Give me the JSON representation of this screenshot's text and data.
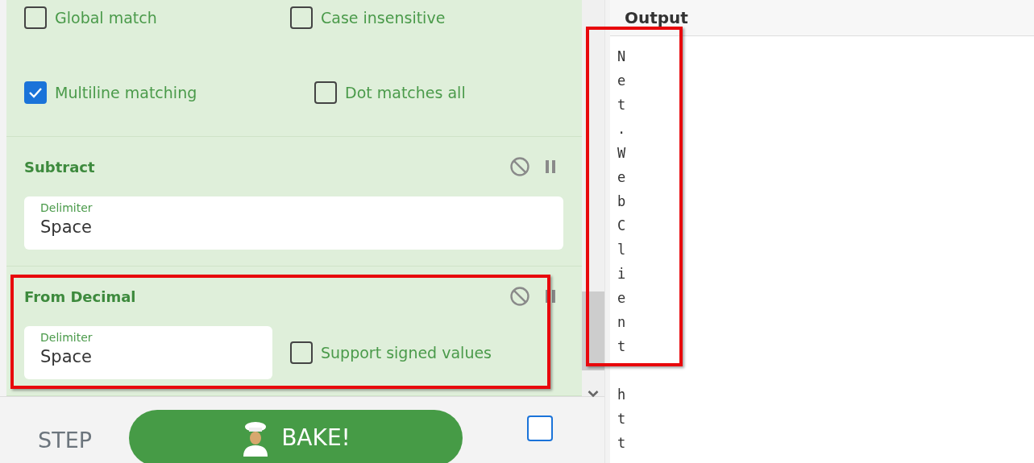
{
  "recipe": {
    "operations": [
      {
        "kind": "options",
        "highlighted": false,
        "checkboxes": [
          {
            "label": "Global match",
            "checked": false
          },
          {
            "label": "Case insensitive",
            "checked": false
          },
          {
            "label": "Multiline matching",
            "checked": true
          },
          {
            "label": "Dot matches all",
            "checked": false
          }
        ]
      },
      {
        "kind": "operation",
        "title": "Subtract",
        "highlighted": false,
        "fields": [
          {
            "label": "Delimiter",
            "value": "Space"
          }
        ]
      },
      {
        "kind": "operation",
        "title": "From Decimal",
        "highlighted": true,
        "fields": [
          {
            "label": "Delimiter",
            "value": "Space"
          }
        ],
        "checkboxes": [
          {
            "label": "Support signed values",
            "checked": false
          }
        ]
      }
    ]
  },
  "controls": {
    "step": "STEP",
    "bake": "BAKE!",
    "auto_bake_checked": false
  },
  "output": {
    "title": "Output",
    "blocks": [
      {
        "text": "N\ne\nt\n.\nW\ne\nb\nC\nl\ni\ne\nn\nt",
        "highlighted": true
      },
      {
        "text": "h\nt\nt",
        "highlighted": false
      }
    ]
  }
}
